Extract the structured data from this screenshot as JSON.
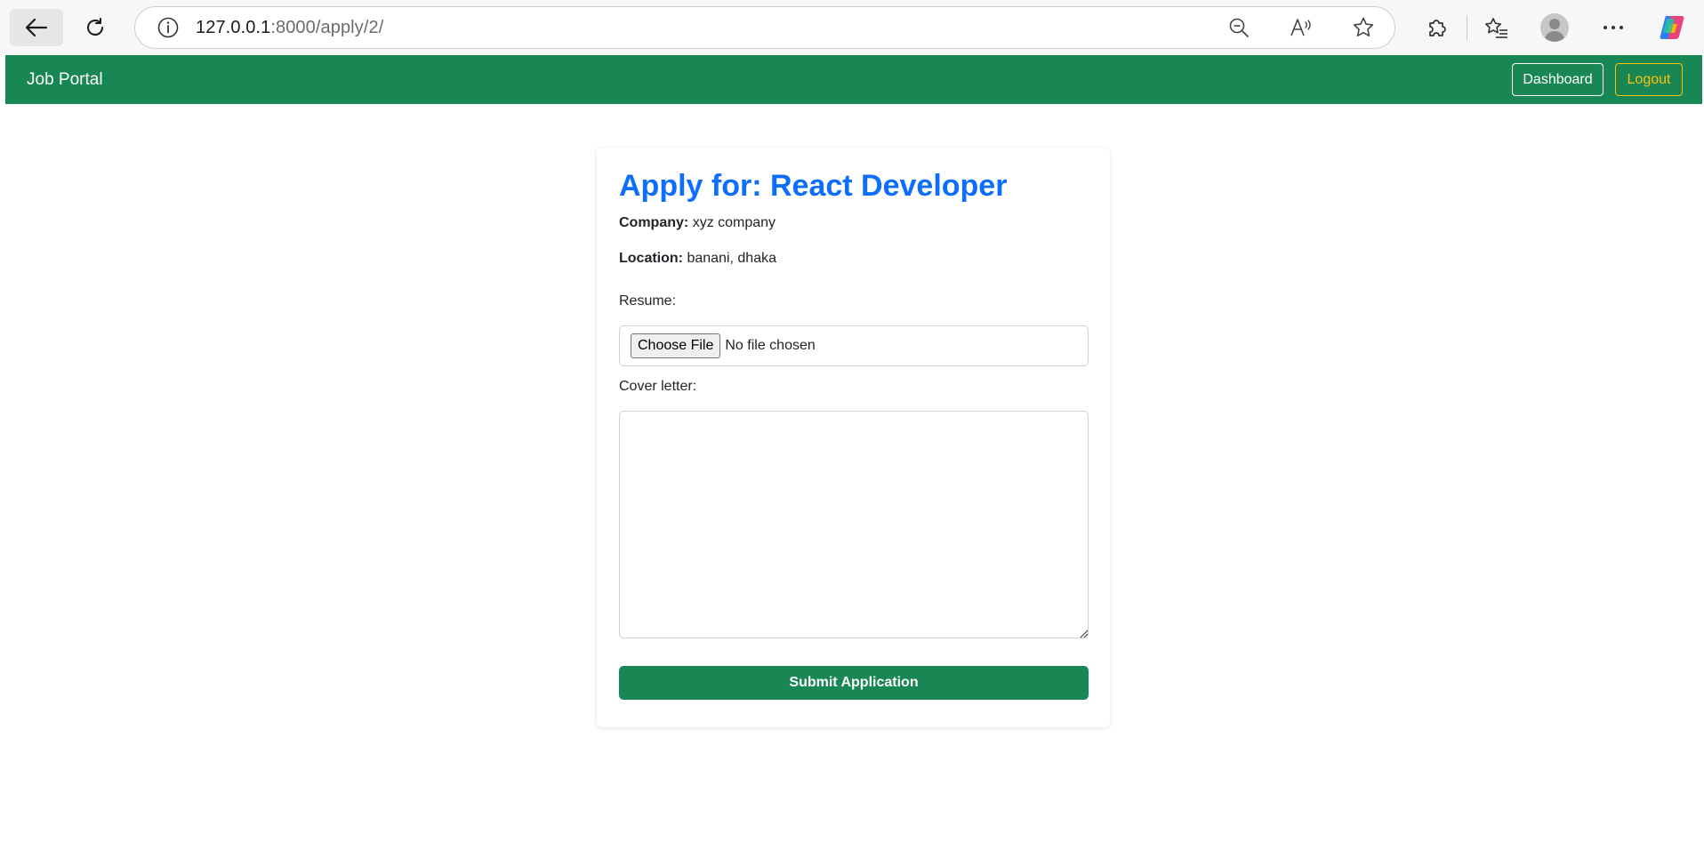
{
  "browser": {
    "url_host": "127.0.0.1",
    "url_rest": ":8000/apply/2/"
  },
  "navbar": {
    "brand": "Job Portal",
    "dashboard_label": "Dashboard",
    "logout_label": "Logout"
  },
  "job": {
    "title": "Apply for: React Developer",
    "company_label": "Company:",
    "company": "xyz company",
    "location_label": "Location:",
    "location": "banani, dhaka"
  },
  "form": {
    "resume_label": "Resume:",
    "choose_file_label": "Choose File",
    "no_file_text": "No file chosen",
    "cover_letter_label": "Cover letter:",
    "cover_letter_value": "",
    "submit_label": "Submit Application"
  },
  "colors": {
    "primary_green": "#198754",
    "title_blue": "#0d6efd",
    "logout_yellow": "#ffc107"
  }
}
